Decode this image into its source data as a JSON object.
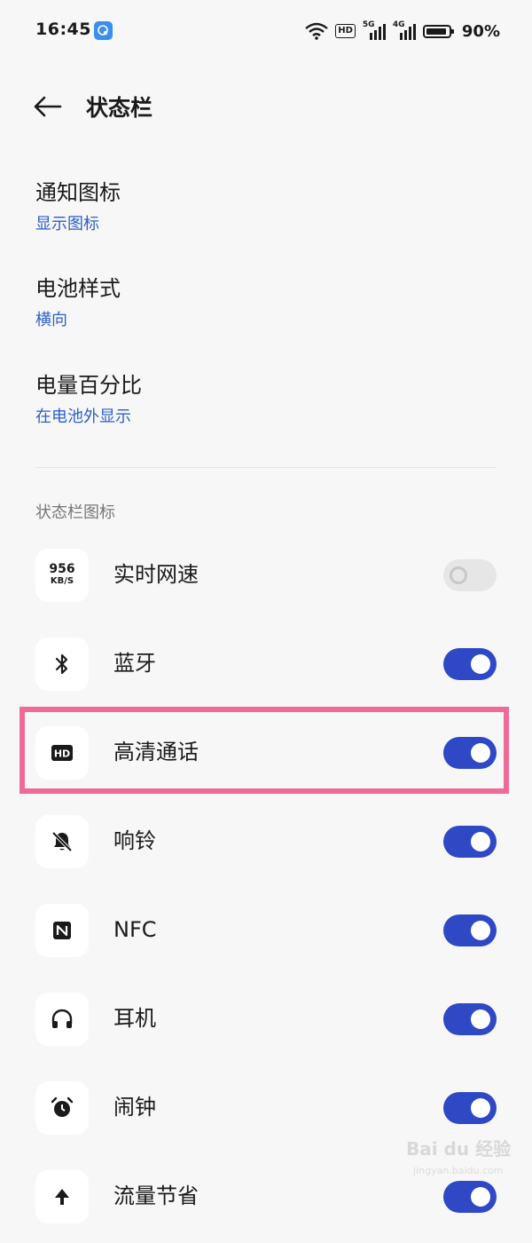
{
  "status_bar": {
    "time": "16:45",
    "hd_badge": "HD",
    "net1": "5G",
    "net2": "4G",
    "battery_percent_text": "90%",
    "battery_level": 0.9
  },
  "header": {
    "title": "状态栏"
  },
  "settings": [
    {
      "title": "通知图标",
      "value": "显示图标"
    },
    {
      "title": "电池样式",
      "value": "横向"
    },
    {
      "title": "电量百分比",
      "value": "在电池外显示"
    }
  ],
  "section": {
    "title": "状态栏图标"
  },
  "net_speed_icon": {
    "value": "956",
    "unit": "KB/S"
  },
  "toggles": [
    {
      "label": "实时网速",
      "icon": "network-speed-icon",
      "enabled": false
    },
    {
      "label": "蓝牙",
      "icon": "bluetooth-icon",
      "enabled": true
    },
    {
      "label": "高清通话",
      "icon": "hd-call-icon",
      "enabled": true
    },
    {
      "label": "响铃",
      "icon": "bell-off-icon",
      "enabled": true
    },
    {
      "label": "NFC",
      "icon": "nfc-icon",
      "enabled": true
    },
    {
      "label": "耳机",
      "icon": "headphones-icon",
      "enabled": true
    },
    {
      "label": "闹钟",
      "icon": "alarm-clock-icon",
      "enabled": true
    },
    {
      "label": "流量节省",
      "icon": "data-saver-icon",
      "enabled": true
    }
  ],
  "watermark": {
    "text": "Bai du 经验",
    "sub": "jingyan.baidu.com"
  },
  "colors": {
    "accent": "#2e48c6",
    "link": "#2d5ec9",
    "highlight": "#f06a96",
    "background": "#f7f7f7"
  }
}
